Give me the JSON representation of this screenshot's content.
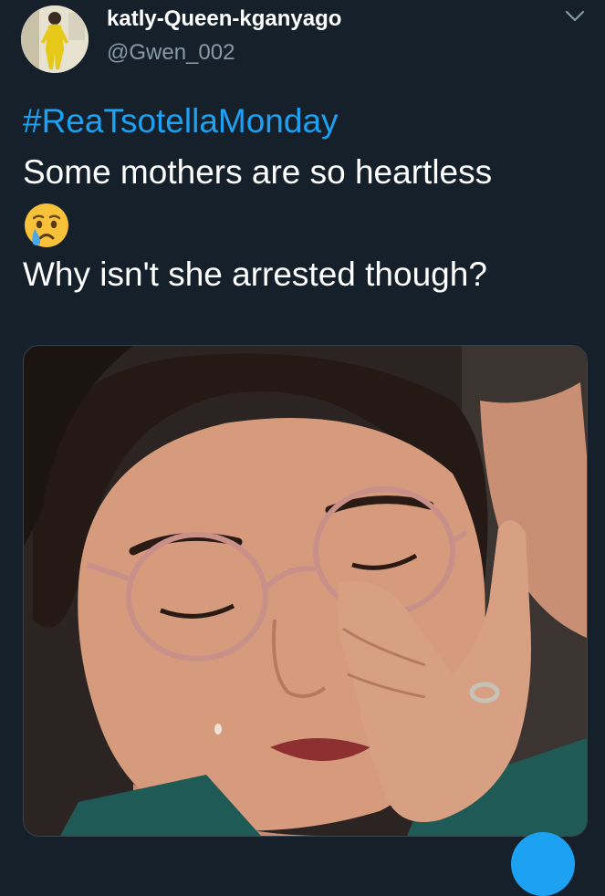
{
  "tweet": {
    "display_name": "katly-Queen-kganyago",
    "handle": "@Gwen_002",
    "hashtag": "#ReaTsotellaMonday",
    "line1": "Some mothers are so heartless",
    "emoji": "crying-face-emoji",
    "line2": "Why isn't she arrested though?"
  },
  "media": {
    "description_icon": "photo-of-woman-with-glasses-wiping-eye"
  },
  "colors": {
    "background": "#15202b",
    "accent": "#1da1f2",
    "secondary_text": "#8899a6"
  }
}
